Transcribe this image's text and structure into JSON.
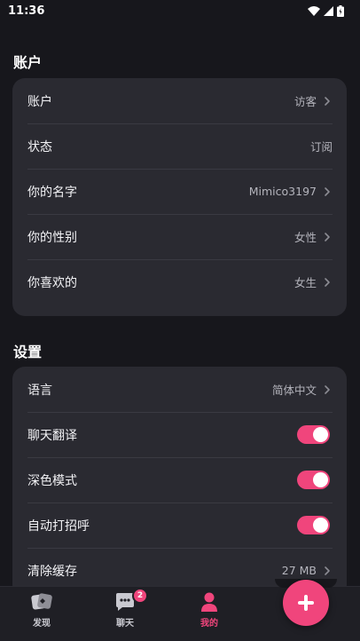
{
  "status_bar": {
    "time": "11:36"
  },
  "account_section": {
    "title": "账户",
    "rows": [
      {
        "label": "账户",
        "value": "访客",
        "chevron": true
      },
      {
        "label": "状态",
        "value": "订阅",
        "chevron": false
      },
      {
        "label": "你的名字",
        "value": "Mimico3197",
        "chevron": true
      },
      {
        "label": "你的性别",
        "value": "女性",
        "chevron": true
      },
      {
        "label": "你喜欢的",
        "value": "女生",
        "chevron": true
      }
    ]
  },
  "settings_section": {
    "title": "设置",
    "language": {
      "label": "语言",
      "value": "简体中文"
    },
    "chat_translate": {
      "label": "聊天翻译",
      "on": true
    },
    "dark_mode": {
      "label": "深色模式",
      "on": true
    },
    "auto_greet": {
      "label": "自动打招呼",
      "on": true
    },
    "clear_cache": {
      "label": "清除缓存",
      "value": "27 MB"
    }
  },
  "tabbar": {
    "discover": {
      "label": "发现",
      "icon": "discover-icon"
    },
    "chat": {
      "label": "聊天",
      "icon": "chat-bubble-icon",
      "badge": "2"
    },
    "me": {
      "label": "我的",
      "icon": "profile-icon",
      "active": true
    },
    "fab_icon": "plus-icon"
  },
  "colors": {
    "accent": "#f0457c",
    "background": "#17171c",
    "card": "#2a2a31"
  }
}
